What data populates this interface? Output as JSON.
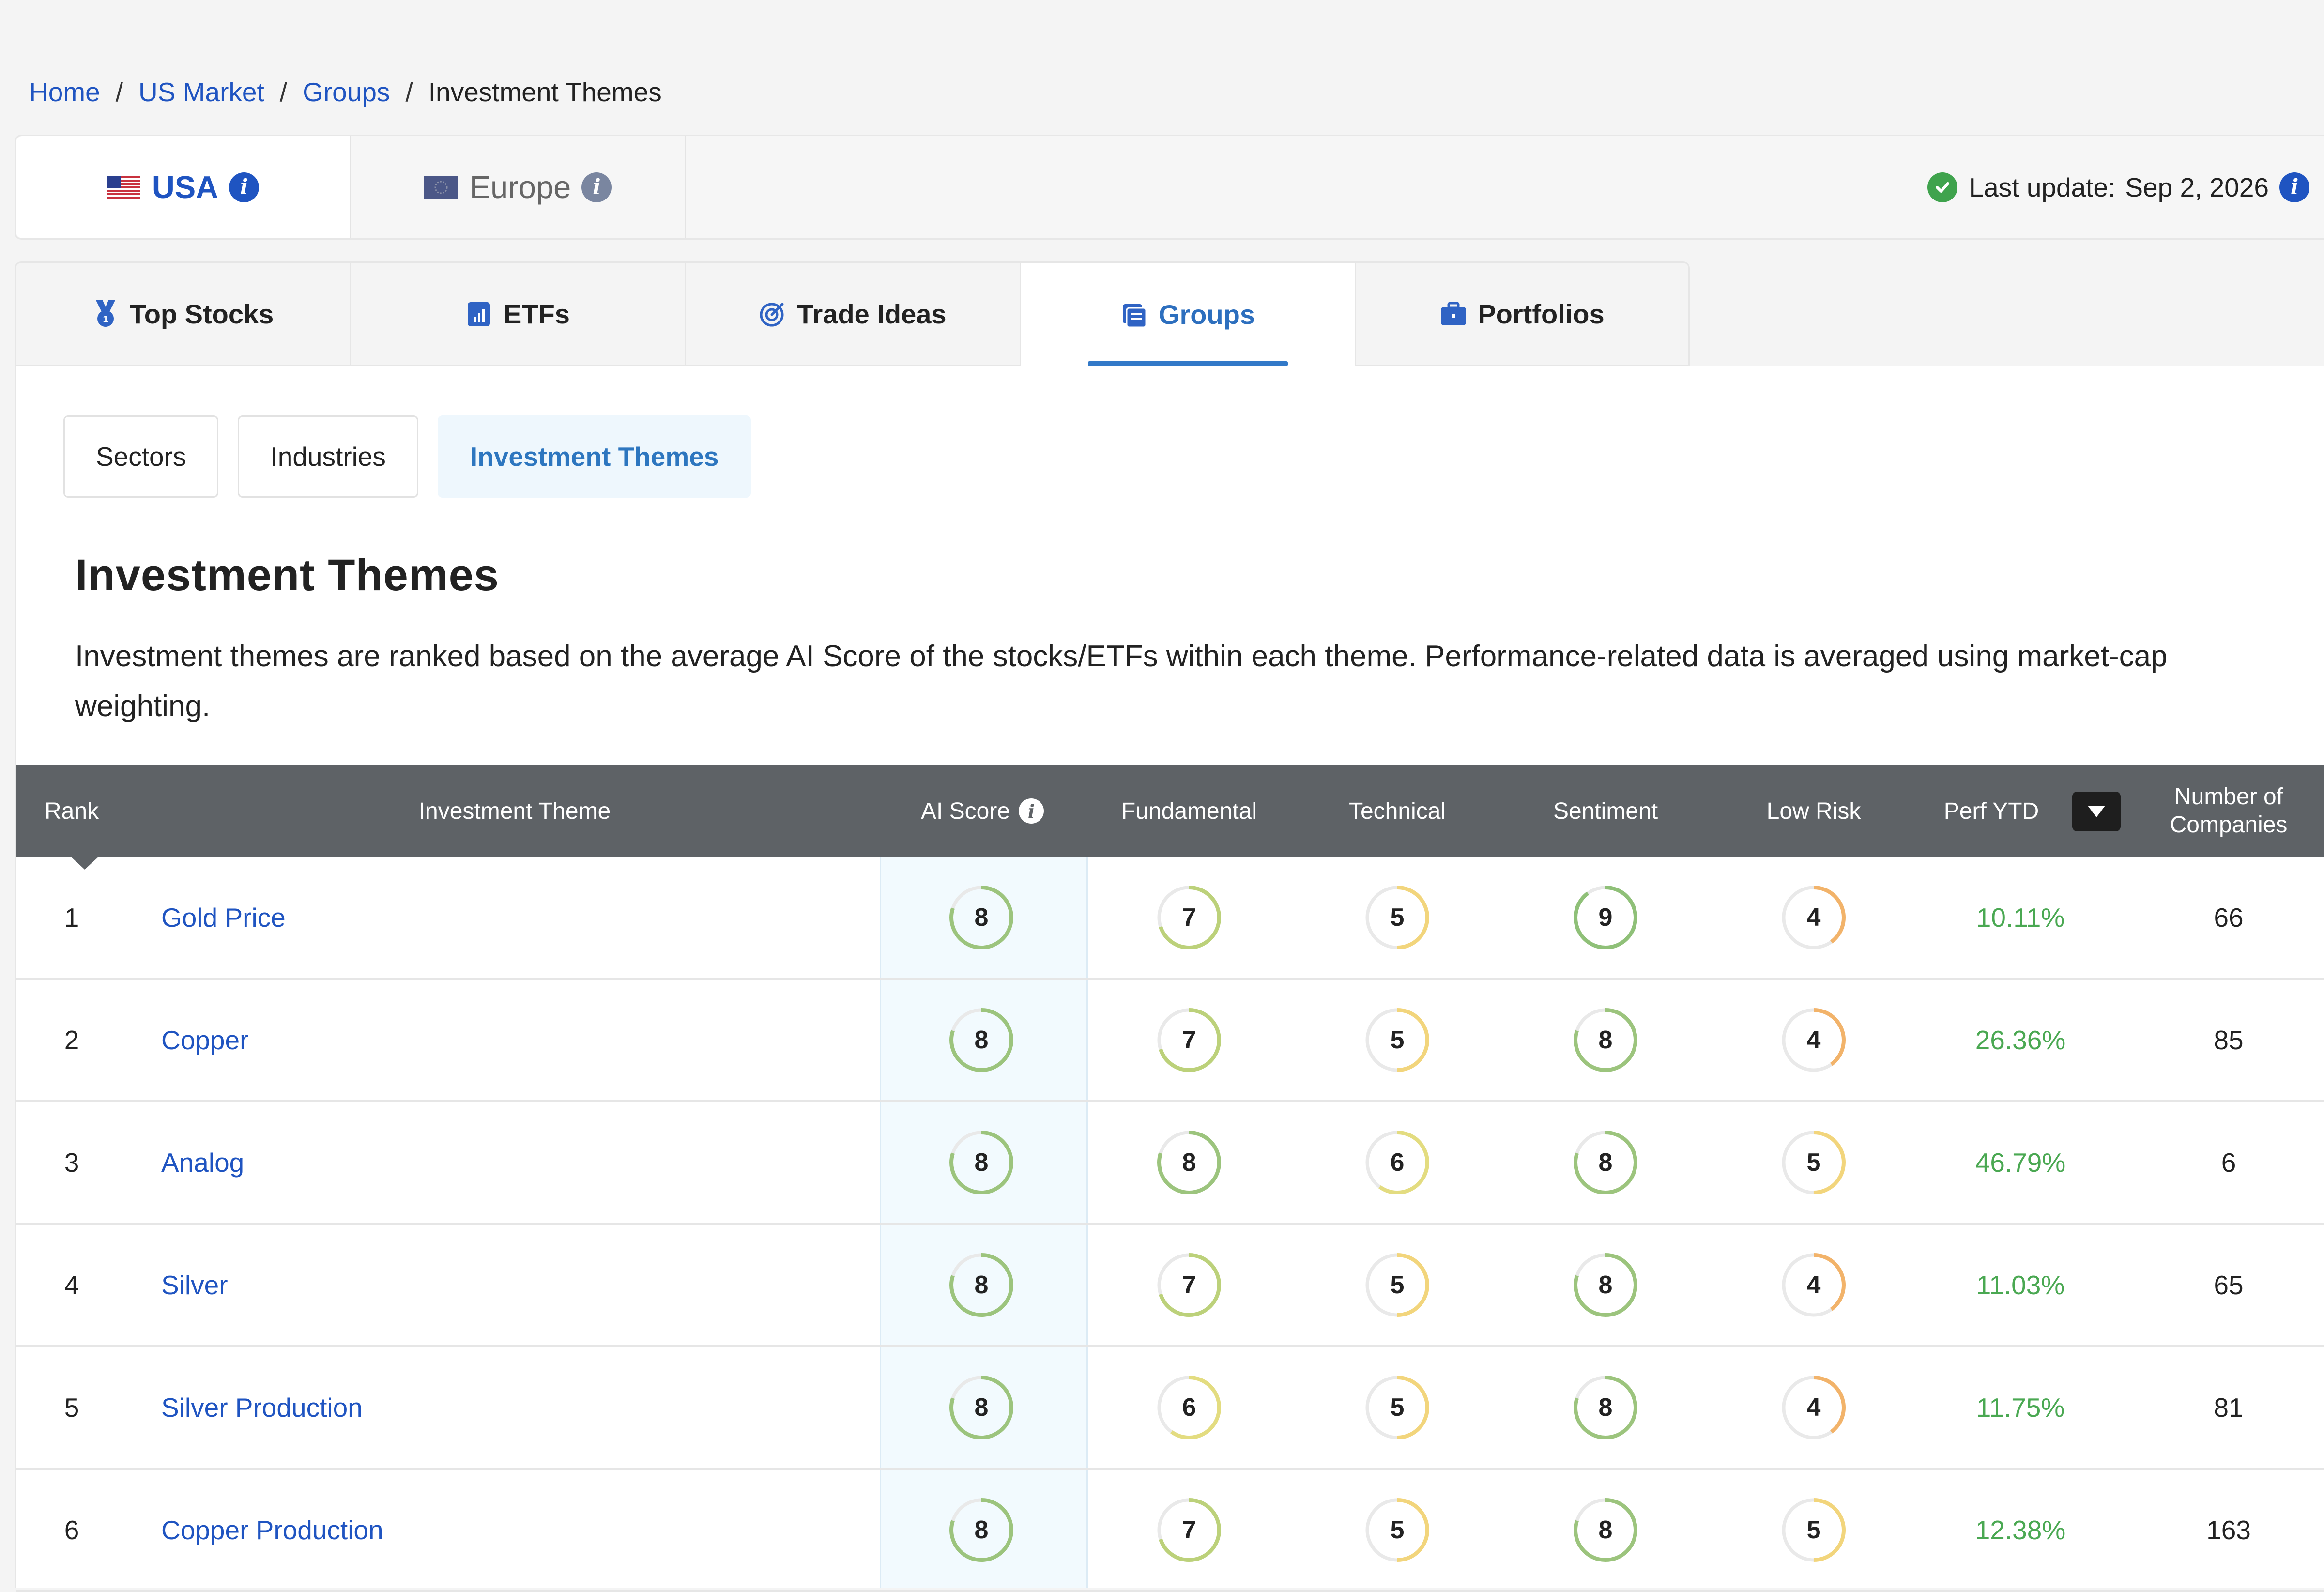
{
  "breadcrumb": {
    "items": [
      "Home",
      "US Market",
      "Groups"
    ],
    "current": "Investment Themes",
    "separator": "/"
  },
  "regions": {
    "usa": {
      "label": "USA",
      "icon": "us-flag-icon"
    },
    "europe": {
      "label": "Europe",
      "icon": "eu-flag-icon"
    }
  },
  "last_update": {
    "label": "Last update:",
    "value": "Sep 2, 2026"
  },
  "main_tabs": [
    {
      "label": "Top Stocks",
      "icon": "medal-icon"
    },
    {
      "label": "ETFs",
      "icon": "chart-doc-icon"
    },
    {
      "label": "Trade Ideas",
      "icon": "target-icon"
    },
    {
      "label": "Groups",
      "icon": "groups-icon",
      "active": true
    },
    {
      "label": "Portfolios",
      "icon": "briefcase-icon"
    }
  ],
  "sub_tabs": [
    {
      "label": "Sectors"
    },
    {
      "label": "Industries"
    },
    {
      "label": "Investment Themes",
      "active": true
    }
  ],
  "section": {
    "title": "Investment Themes",
    "description": "Investment themes are ranked based on the average AI Score of the stocks/ETFs within each theme. Performance-related data is averaged using market-cap weighting."
  },
  "table": {
    "headers": {
      "rank": "Rank",
      "theme": "Investment Theme",
      "ai_score": "AI Score",
      "fundamental": "Fundamental",
      "technical": "Technical",
      "sentiment": "Sentiment",
      "low_risk": "Low Risk",
      "perf_ytd": "Perf YTD",
      "number_line1": "Number of",
      "number_line2": "Companies"
    },
    "sort": {
      "column": "Perf YTD",
      "direction": "descending",
      "icon": "caret-down-icon"
    },
    "rows": [
      {
        "rank": "1",
        "theme": "Gold Price",
        "ai_score": 8,
        "fundamental": 7,
        "technical": 5,
        "sentiment": 9,
        "low_risk": 4,
        "perf_ytd": "10.11%",
        "companies": "66"
      },
      {
        "rank": "2",
        "theme": "Copper",
        "ai_score": 8,
        "fundamental": 7,
        "technical": 5,
        "sentiment": 8,
        "low_risk": 4,
        "perf_ytd": "26.36%",
        "companies": "85"
      },
      {
        "rank": "3",
        "theme": "Analog",
        "ai_score": 8,
        "fundamental": 8,
        "technical": 6,
        "sentiment": 8,
        "low_risk": 5,
        "perf_ytd": "46.79%",
        "companies": "6"
      },
      {
        "rank": "4",
        "theme": "Silver",
        "ai_score": 8,
        "fundamental": 7,
        "technical": 5,
        "sentiment": 8,
        "low_risk": 4,
        "perf_ytd": "11.03%",
        "companies": "65"
      },
      {
        "rank": "5",
        "theme": "Silver Production",
        "ai_score": 8,
        "fundamental": 6,
        "technical": 5,
        "sentiment": 8,
        "low_risk": 4,
        "perf_ytd": "11.75%",
        "companies": "81"
      },
      {
        "rank": "6",
        "theme": "Copper Production",
        "ai_score": 8,
        "fundamental": 7,
        "technical": 5,
        "sentiment": 8,
        "low_risk": 5,
        "perf_ytd": "12.38%",
        "companies": "163"
      }
    ]
  },
  "score_colors": {
    "9": "#8fc078",
    "8": "#9cc47d",
    "7": "#bcd17a",
    "6": "#e3dc80",
    "5": "#f2d57c",
    "4": "#f2b36a",
    "track": "#e9e9e9"
  },
  "colors": {
    "accent": "#1f54c1",
    "active_tab": "#2d6fbe",
    "header_bg": "#5e6266",
    "perf_positive": "#4aa852"
  }
}
